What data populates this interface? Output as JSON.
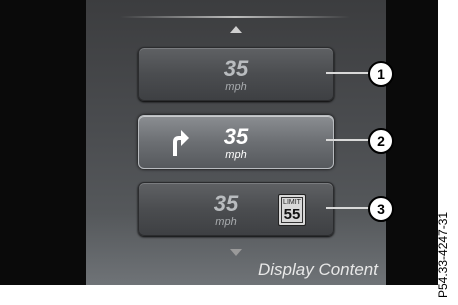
{
  "buttons": [
    {
      "speed": "35",
      "unit": "mph"
    },
    {
      "speed": "35",
      "unit": "mph"
    },
    {
      "speed": "35",
      "unit": "mph",
      "limit_label": "LIMIT",
      "limit_value": "55"
    }
  ],
  "callouts": [
    "1",
    "2",
    "3"
  ],
  "footer": {
    "label": "Display Content"
  },
  "figure_code": "P54.33-4247-31"
}
